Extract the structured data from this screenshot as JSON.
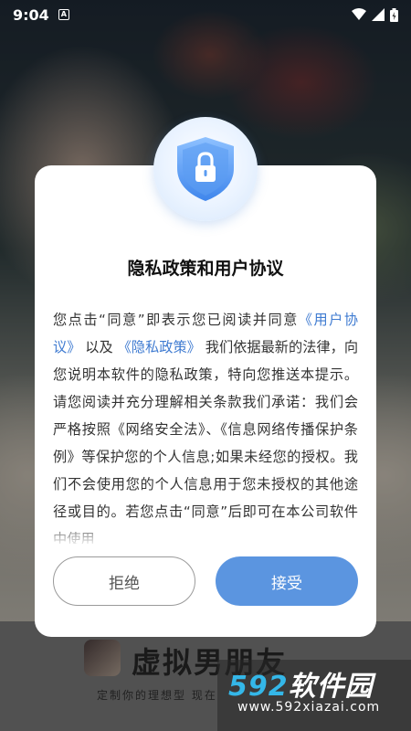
{
  "status_bar": {
    "time": "9:04",
    "notification_letter": "A"
  },
  "app": {
    "name": "虚拟男朋友",
    "slogan": "定制你的理想型  现在"
  },
  "dialog": {
    "title": "隐私政策和用户协议",
    "body": {
      "p1": "您点击“同意”即表示您已阅读并同意",
      "link_user": "《用户协议》",
      "p2": "以及",
      "link_privacy": "《隐私政策》",
      "p3": "我们依据最新的法律，向您说明本软件的隐私政策，特向您推送本提示。请您阅读并充分理解相关条款我们承诺：我们会严格按照《网络安全法》、《信息网络传播保护条例》等保护您的个人信息;如果未经您的授权。我们不会使用您的个人信息用于您未授权的其他途径或目的。若您点击“同意”后即可在本公司软件中使用"
    },
    "reject_label": "拒绝",
    "accept_label": "接受"
  },
  "watermark": {
    "digits": "592",
    "cn": "软件园",
    "url": "www.592xiazai.com"
  },
  "colors": {
    "accent": "#5b95e0",
    "link": "#3f7bd1"
  }
}
